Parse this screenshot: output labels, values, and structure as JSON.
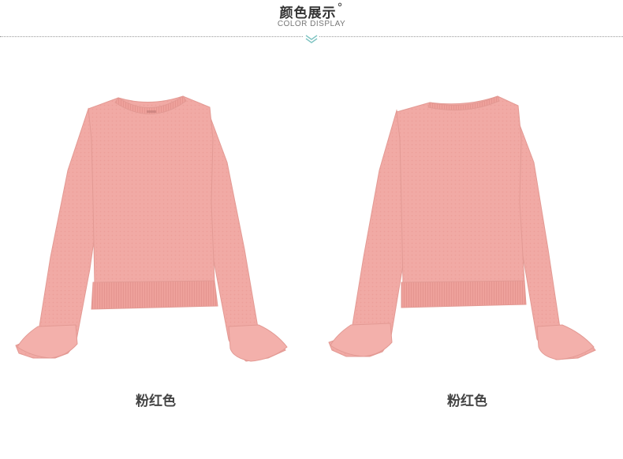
{
  "header": {
    "title": "颜色展示",
    "title_mark": "°",
    "subtitle": "COLOR DISPLAY",
    "divider_icon": "chevron-down-icon",
    "accent_color": "#7fc4c2"
  },
  "products": [
    {
      "view": "front",
      "color_name": "粉红色",
      "swatch": "#f1aaa5"
    },
    {
      "view": "back",
      "color_name": "粉红色",
      "swatch": "#f1aaa5"
    }
  ]
}
